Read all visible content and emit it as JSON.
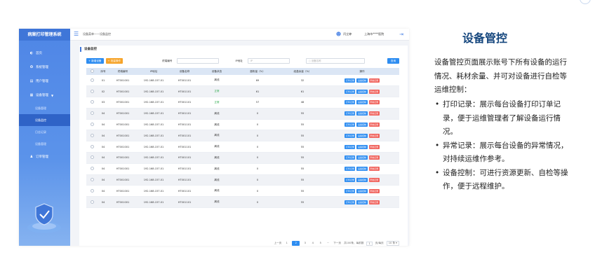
{
  "app": {
    "title": "病案打印管理系统"
  },
  "sidebar": {
    "items": [
      {
        "label": "首页",
        "icon": "home-icon"
      },
      {
        "label": "系统管理",
        "icon": "settings-icon"
      },
      {
        "label": "用户管理",
        "icon": "user-icon"
      },
      {
        "label": "设备管理",
        "icon": "device-icon"
      }
    ],
    "submenu": [
      {
        "label": "设备管理",
        "active": false
      },
      {
        "label": "设备监控",
        "active": true
      },
      {
        "label": "日志记录",
        "active": false
      },
      {
        "label": "设备管理",
        "active": false
      }
    ],
    "bottom_item": {
      "label": "订单管理",
      "icon": "person-icon"
    }
  },
  "topbar": {
    "breadcrumb": "设备菜单——设备监控",
    "user": "闫立婷",
    "org": "上海市****医院"
  },
  "page": {
    "title": "设备监控"
  },
  "filters": {
    "add_button": "+ 新增设备",
    "batch_button": "+ 批量操作",
    "terminal_label": "终端编号",
    "ip_label": "IP地址",
    "ip_placeholder": "IP",
    "name_placeholder": "设备名称",
    "search_button": "查询"
  },
  "table": {
    "columns": [
      "序号",
      "终端编号",
      "IP地址",
      "设备名称",
      "设备状态",
      "墨粉量（%）",
      "纸盒余量（%）",
      "操作"
    ],
    "actions": [
      "打印记录",
      "设备控制",
      "异常记录"
    ],
    "rows": [
      {
        "no": "01",
        "terminal": "HT001001",
        "ip": "192.168.157.01",
        "name": "HT001101",
        "status": "离线",
        "toner": "69",
        "paper": "32"
      },
      {
        "no": "02",
        "terminal": "HT001001",
        "ip": "192.168.157.01",
        "name": "HT001101",
        "status": "正常",
        "toner": "61",
        "paper": "61"
      },
      {
        "no": "03",
        "terminal": "HT001001",
        "ip": "192.168.157.01",
        "name": "HT001101",
        "status": "正常",
        "toner": "57",
        "paper": "48"
      },
      {
        "no": "04",
        "terminal": "HT001001",
        "ip": "192.168.157.01",
        "name": "HT001101",
        "status": "离线",
        "toner": "0",
        "paper": "55"
      },
      {
        "no": "04",
        "terminal": "HT001001",
        "ip": "192.168.157.01",
        "name": "HT001101",
        "status": "离线",
        "toner": "0",
        "paper": "55"
      },
      {
        "no": "04",
        "terminal": "HT001001",
        "ip": "192.168.157.01",
        "name": "HT001101",
        "status": "离线",
        "toner": "0",
        "paper": "55"
      },
      {
        "no": "04",
        "terminal": "HT001001",
        "ip": "192.168.157.01",
        "name": "HT001101",
        "status": "离线",
        "toner": "0",
        "paper": "55"
      },
      {
        "no": "04",
        "terminal": "HT001001",
        "ip": "192.168.157.01",
        "name": "HT001101",
        "status": "离线",
        "toner": "0",
        "paper": "55"
      },
      {
        "no": "04",
        "terminal": "HT001001",
        "ip": "192.168.157.01",
        "name": "HT001101",
        "status": "离线",
        "toner": "0",
        "paper": "55"
      },
      {
        "no": "04",
        "terminal": "HT001001",
        "ip": "192.168.157.01",
        "name": "HT001101",
        "status": "离线",
        "toner": "0",
        "paper": "55"
      },
      {
        "no": "04",
        "terminal": "HT001001",
        "ip": "192.168.157.01",
        "name": "HT001101",
        "status": "离线",
        "toner": "0",
        "paper": "55"
      },
      {
        "no": "04",
        "terminal": "HT001001",
        "ip": "192.168.157.01",
        "name": "HT001101",
        "status": "离线",
        "toner": "0",
        "paper": "55"
      }
    ]
  },
  "pagination": {
    "prev": "上一页",
    "pages": [
      "1",
      "2",
      "3",
      "4",
      "5",
      "···"
    ],
    "current": "2",
    "next": "下一页",
    "total": "共100条，每前数",
    "goto_value": "1",
    "goto_label": "页/每页",
    "page_size": "10 条 ▾"
  },
  "description": {
    "title": "设备管控",
    "intro": "设备管控页面展示账号下所有设备的运行情况、耗材余量、并可对设备进行自检等运维控制：",
    "points": [
      "打印记录：展示每台设备打印订单记录，便于运维管理者了解设备运行情况。",
      "异常记录：展示每台设备的异常情况，对持续运维作参考。",
      "设备控制：可进行资源更新、自检等操作，便于远程维护。"
    ]
  },
  "colors": {
    "primary": "#2e8df1",
    "sidebar": "#4f86e6",
    "title": "#16477e",
    "online": "#2aa84a",
    "danger": "#f0625c",
    "warning": "#f6a42a"
  }
}
